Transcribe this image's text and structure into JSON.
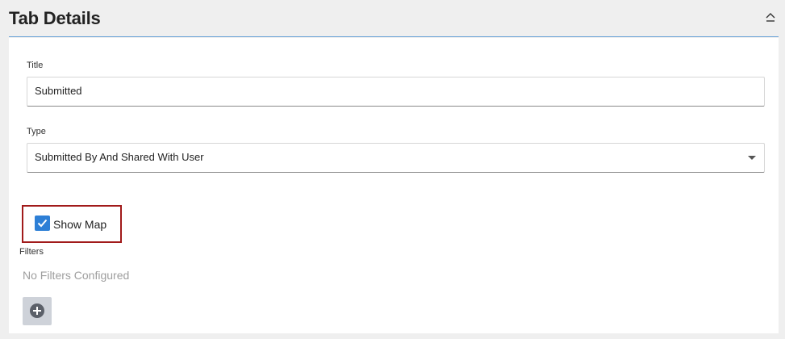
{
  "header": {
    "title": "Tab Details"
  },
  "form": {
    "title_label": "Title",
    "title_value": "Submitted",
    "type_label": "Type",
    "type_value": "Submitted By And Shared With User",
    "show_map_label": "Show Map",
    "show_map_checked": true,
    "filters_label": "Filters",
    "filters_empty_text": "No Filters Configured"
  },
  "icons": {
    "collapse": "chevron-up-icon",
    "dropdown": "caret-down-icon",
    "checkbox": "checkmark-icon",
    "add": "plus-circle-icon"
  },
  "colors": {
    "accent": "#2d7fd6",
    "highlight": "#a11a1a",
    "header_rule": "#6aa3d8"
  }
}
